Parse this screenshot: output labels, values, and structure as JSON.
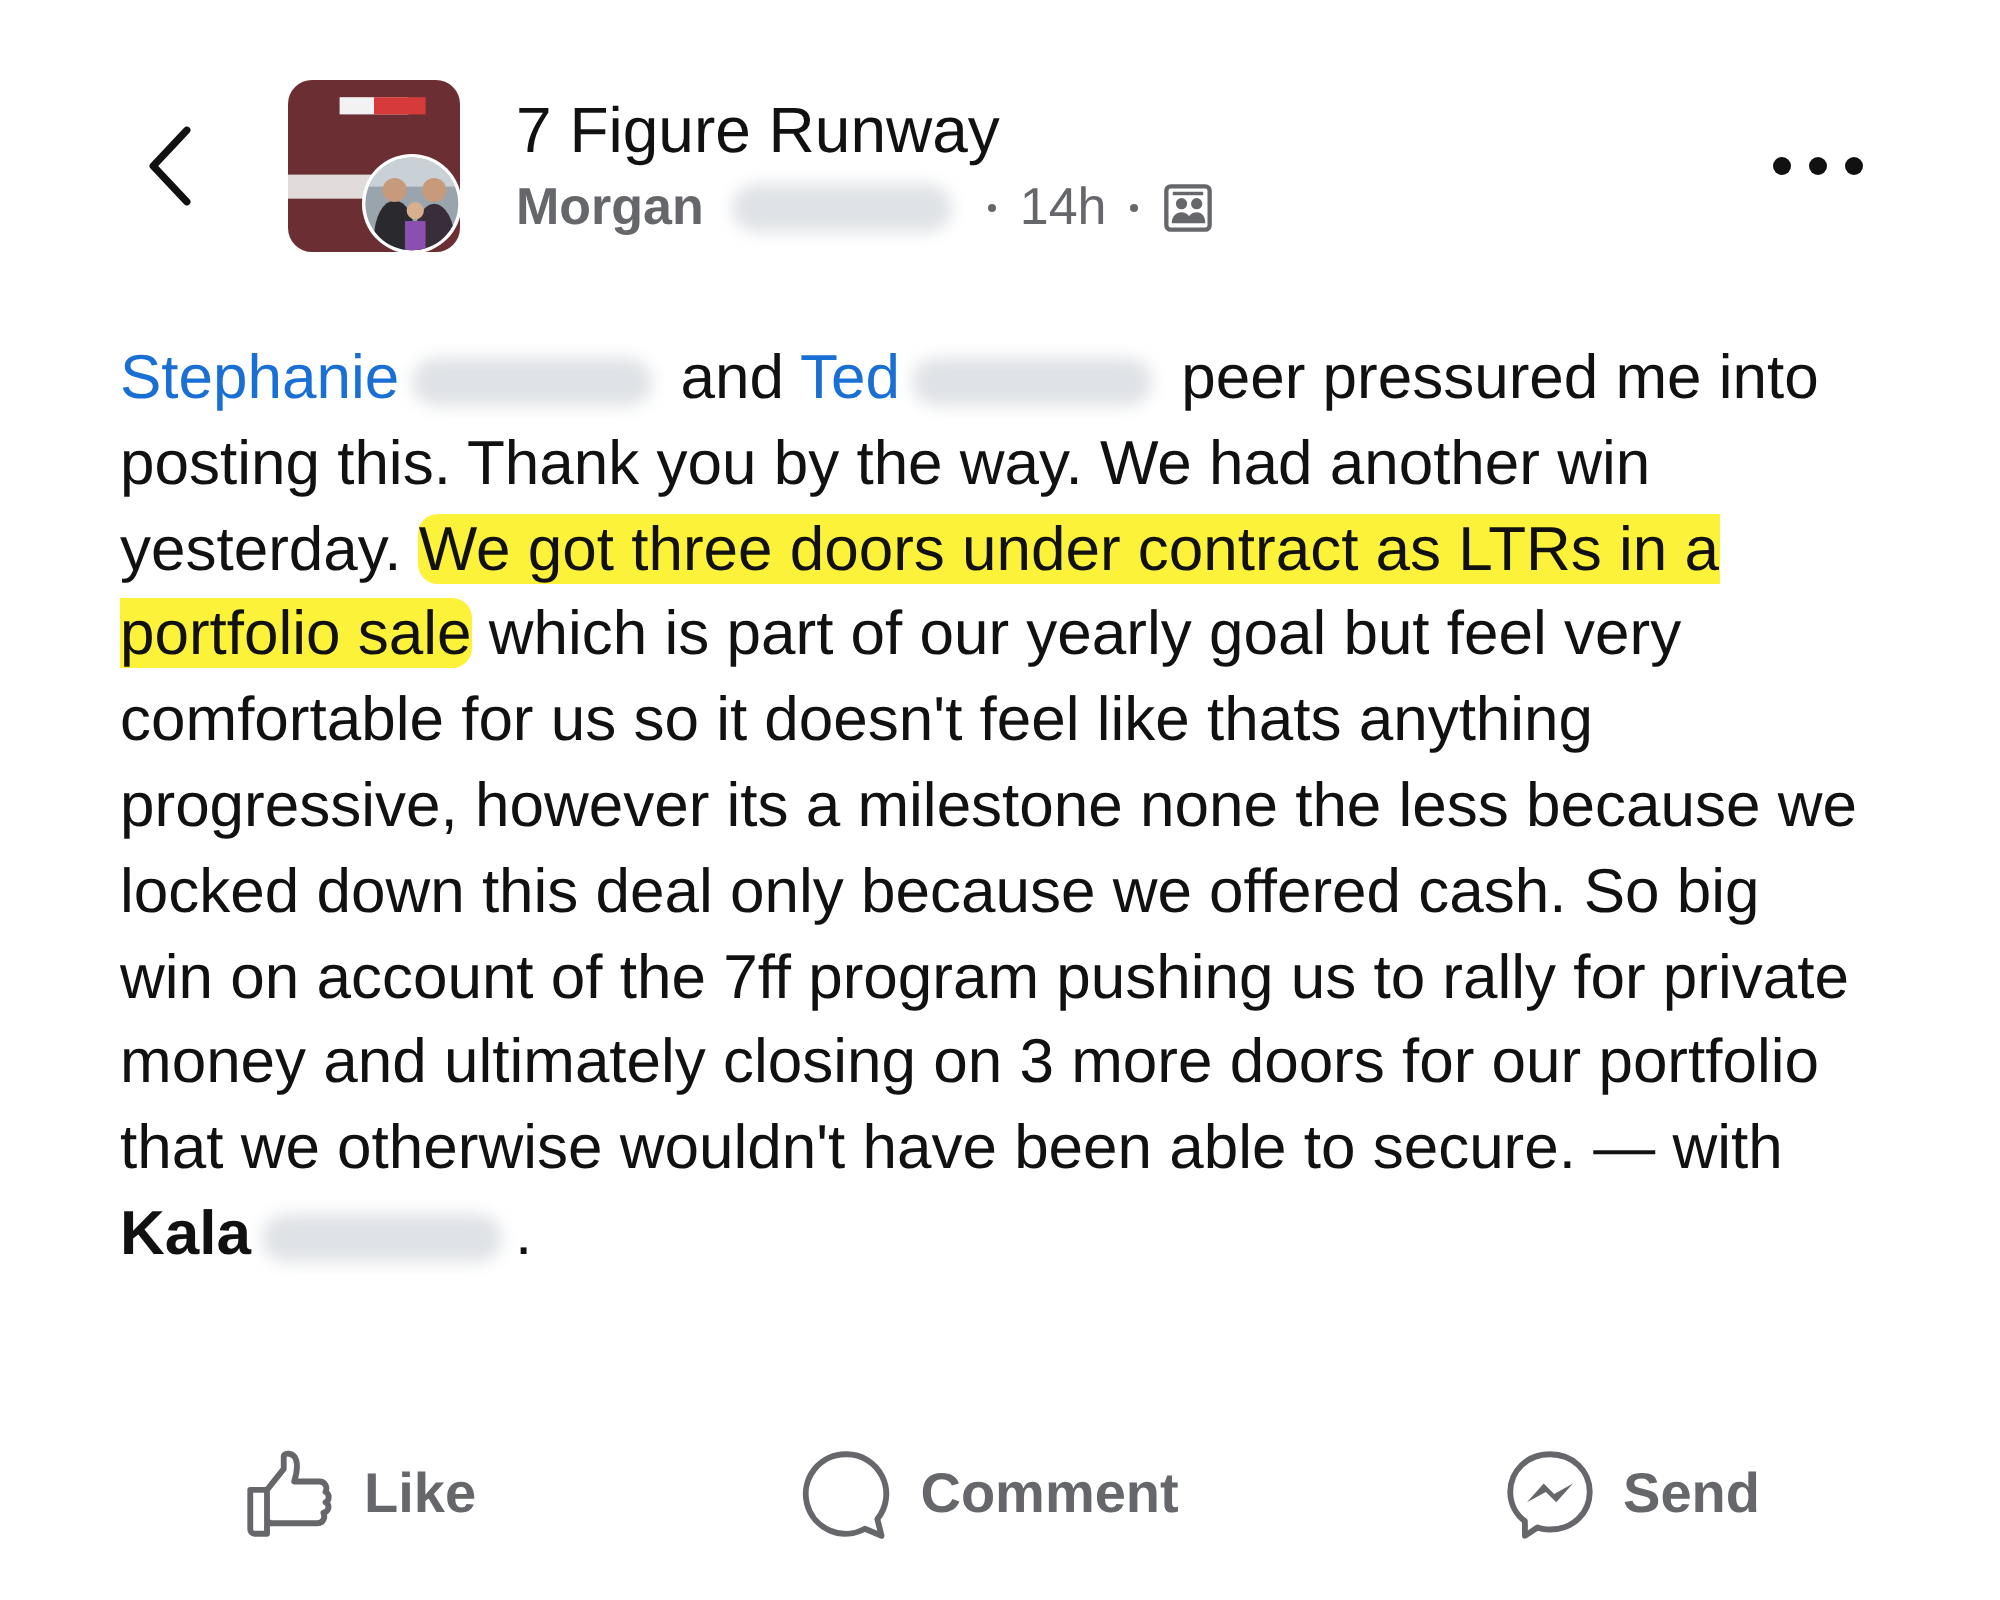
{
  "header": {
    "group_name": "7 Figure Runway",
    "author": "Morgan",
    "time": "14h"
  },
  "post": {
    "segments": [
      {
        "kind": "mention",
        "text": "Stephanie"
      },
      {
        "kind": "redacted"
      },
      {
        "kind": "text",
        "text": " and "
      },
      {
        "kind": "mention",
        "text": "Ted"
      },
      {
        "kind": "redacted"
      },
      {
        "kind": "text",
        "text": " peer pressured me into posting this. Thank you by the way. We had another win yesterday. "
      },
      {
        "kind": "highlight",
        "text": "We got three doors under contract as LTRs in a portfolio sale"
      },
      {
        "kind": "text",
        "text": " which is part of our yearly goal but feel very comfortable for us so it doesn't feel like thats anything progressive, however its a milestone none the less because we locked down this deal only because we offered cash. So big win on account of the 7ff program pushing us to rally for private money and ultimately closing on 3 more doors for our portfolio that we otherwise wouldn't have been able to secure. — with "
      },
      {
        "kind": "bold",
        "text": "Kala"
      },
      {
        "kind": "redacted"
      },
      {
        "kind": "text",
        "text": "."
      }
    ]
  },
  "actions": [
    {
      "kind": "like",
      "label": "Like"
    },
    {
      "kind": "comment",
      "label": "Comment"
    },
    {
      "kind": "send",
      "label": "Send"
    }
  ]
}
